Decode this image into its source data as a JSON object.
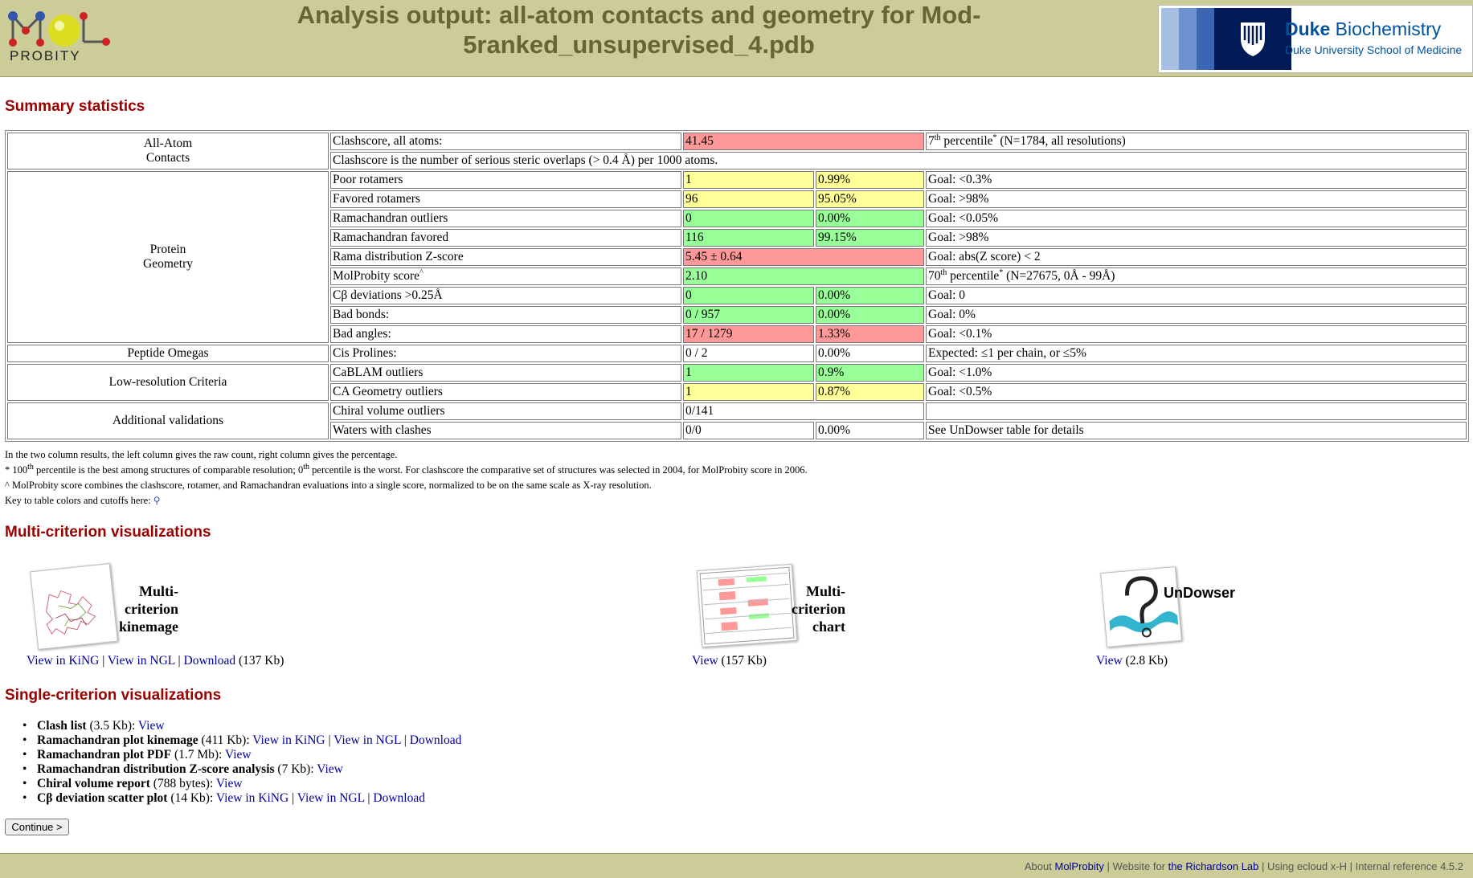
{
  "header": {
    "title_line1": "Analysis output: all-atom contacts and geometry for Mod-",
    "title_line2": "5ranked_unsupervised_4.pdb",
    "logo_text": "PROBITY",
    "duke_name_bold": "Duke",
    "duke_name": " Biochemistry",
    "duke_sub": "Duke University School of Medicine"
  },
  "summary": {
    "heading": "Summary statistics",
    "cat_allatom_1": "All-Atom",
    "cat_allatom_2": "Contacts",
    "cat_protein_1": "Protein",
    "cat_protein_2": "Geometry",
    "cat_omega": "Peptide Omegas",
    "cat_lowres": "Low-resolution Criteria",
    "cat_additional": "Additional validations",
    "clash_label": "Clashscore, all atoms:",
    "clash_value": "41.45",
    "clash_pct_pre": "7",
    "clash_pct_sup": "th",
    "clash_pct_word": " percentile",
    "clash_pct_post": " (N=1784, all resolutions)",
    "clash_desc": "Clashscore is the number of serious steric overlaps (> 0.4 Å) per 1000 atoms.",
    "poor_rot_label": "Poor rotamers",
    "poor_rot_count": "1",
    "poor_rot_pct": "0.99%",
    "poor_rot_goal": "Goal: <0.3%",
    "fav_rot_label": "Favored rotamers",
    "fav_rot_count": "96",
    "fav_rot_pct": "95.05%",
    "fav_rot_goal": "Goal: >98%",
    "rama_out_label": "Ramachandran outliers",
    "rama_out_count": "0",
    "rama_out_pct": "0.00%",
    "rama_out_goal": "Goal: <0.05%",
    "rama_fav_label": "Ramachandran favored",
    "rama_fav_count": "116",
    "rama_fav_pct": "99.15%",
    "rama_fav_goal": "Goal: >98%",
    "rama_z_label": "Rama distribution Z-score",
    "rama_z_value": "5.45 ± 0.64",
    "rama_z_goal": "Goal: abs(Z score) < 2",
    "mp_label": "MolProbity score",
    "mp_value": "2.10",
    "mp_pct_pre": "70",
    "mp_pct_sup": "th",
    "mp_pct_word": " percentile",
    "mp_pct_post": " (N=27675, 0Å - 99Å)",
    "cb_label": "Cβ deviations >0.25Å",
    "cb_count": "0",
    "cb_pct": "0.00%",
    "cb_goal": "Goal: 0",
    "bonds_label": "Bad bonds:",
    "bonds_count": "0 / 957",
    "bonds_pct": "0.00%",
    "bonds_goal": "Goal: 0%",
    "angles_label": "Bad angles:",
    "angles_count": "17 / 1279",
    "angles_pct": "1.33%",
    "angles_goal": "Goal: <0.1%",
    "cis_label": "Cis Prolines:",
    "cis_count": "0 / 2",
    "cis_pct": "0.00%",
    "cis_goal": "Expected: ≤1 per chain, or ≤5%",
    "cablam_label": "CaBLAM outliers",
    "cablam_count": "1",
    "cablam_pct": "0.9%",
    "cablam_goal": "Goal: <1.0%",
    "cageo_label": "CA Geometry outliers",
    "cageo_count": "1",
    "cageo_pct": "0.87%",
    "cageo_goal": "Goal: <0.5%",
    "chiral_label": "Chiral volume outliers",
    "chiral_value": "0/141",
    "waters_label": "Waters with clashes",
    "waters_count": "0/0",
    "waters_pct": "0.00%",
    "waters_goal": "See UnDowser table for details"
  },
  "notes": {
    "line1": "In the two column results, the left column gives the raw count, right column gives the percentage.",
    "line2_a": "* 100",
    "line2_b": " percentile is the best among structures of comparable resolution; 0",
    "line2_c": " percentile is the worst. For clashscore the comparative set of structures was selected in 2004, for MolProbity score in 2006.",
    "sup_th": "th",
    "line3": "^ MolProbity score combines the clashscore, rotamer, and Ramachandran evaluations into a single score, normalized to be on the same scale as X-ray resolution.",
    "line4": "Key to table colors and cutoffs here: "
  },
  "multi": {
    "heading": "Multi-criterion visualizations",
    "kin_title1": "Multi-criterion",
    "kin_title2": "kinemage",
    "kin_view_king": "View in KiNG",
    "kin_view_ngl": "View in NGL",
    "kin_download": "Download",
    "kin_size": " (137 Kb)",
    "chart_title1": "Multi-criterion",
    "chart_title2": "chart",
    "chart_view": "View",
    "chart_size": " (157 Kb)",
    "undowser_title": "UnDowser",
    "undowser_view": "View",
    "undowser_size": " (2.8 Kb)",
    "sep": " | "
  },
  "single": {
    "heading": "Single-criterion visualizations",
    "items": [
      {
        "name": "Clash list",
        "size": " (3.5 Kb): ",
        "links": [
          "View"
        ]
      },
      {
        "name": "Ramachandran plot kinemage",
        "size": " (411 Kb): ",
        "links": [
          "View in KiNG",
          "View in NGL",
          "Download"
        ]
      },
      {
        "name": "Ramachandran plot PDF",
        "size": " (1.7 Mb): ",
        "links": [
          "View"
        ]
      },
      {
        "name": "Ramachandran distribution Z-score analysis",
        "size": " (7 Kb): ",
        "links": [
          "View"
        ]
      },
      {
        "name": "Chiral volume report",
        "size": " (788 bytes): ",
        "links": [
          "View"
        ]
      },
      {
        "name": "Cβ deviation scatter plot",
        "size": " (14 Kb): ",
        "links": [
          "View in KiNG",
          "View in NGL",
          "Download"
        ]
      }
    ]
  },
  "continue_label": "Continue >",
  "footer": {
    "about": "About ",
    "molprobity": "MolProbity",
    "website": " | Website for ",
    "richardson": "the Richardson Lab",
    "rest": " | Using ecloud x-H | Internal reference 4.5.2"
  },
  "colors": {
    "header_bg": "#cccc99",
    "heading": "#990000",
    "red_cell": "#ff9999",
    "yellow_cell": "#ffff99",
    "green_cell": "#99ff99",
    "link": "#000099"
  }
}
